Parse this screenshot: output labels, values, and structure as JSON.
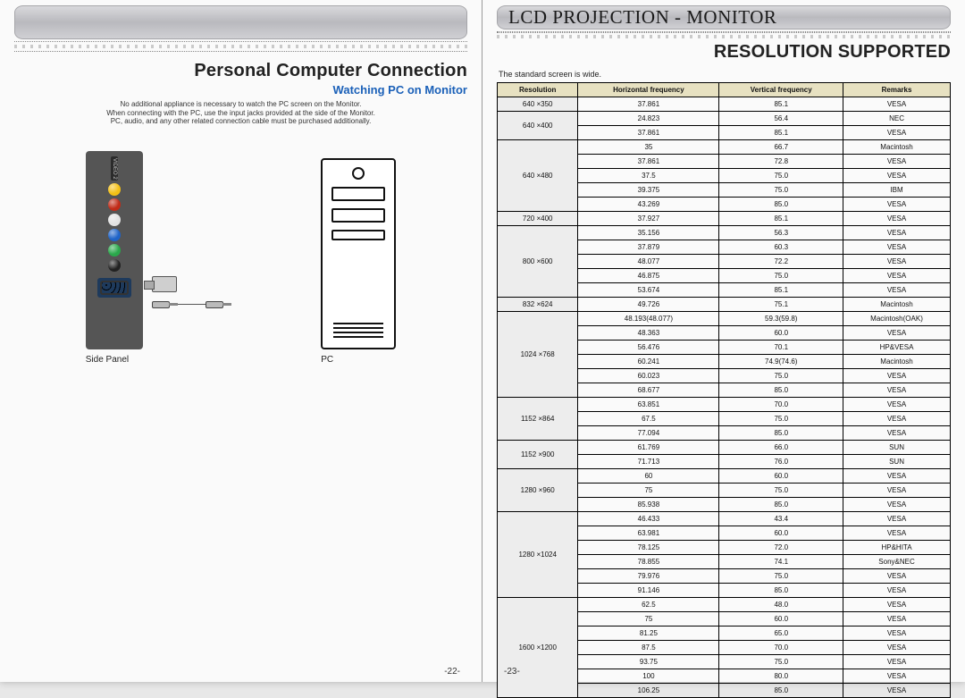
{
  "left": {
    "header": "",
    "title": "Personal Computer Connection",
    "subtitle": "Watching PC on Monitor",
    "intro1": "No additional appliance is necessary to watch the PC screen on the Monitor.",
    "intro2": "When connecting with the PC, use the input jacks provided at the side of the Monitor.",
    "intro3": "PC, audio, and any other related connection cable must be purchased additionally.",
    "sidepanel_label": "Side Panel",
    "pc_label": "PC",
    "pageno": "-22-"
  },
  "right": {
    "header": "LCD PROJECTION -  MONITOR",
    "title": "RESOLUTION SUPPORTED",
    "caption": "The standard screen is wide.",
    "pageno": "-23-",
    "table": {
      "headers": [
        "Resolution",
        "Horizontal frequency",
        "Vertical frequency",
        "Remarks"
      ],
      "groups": [
        {
          "res": "640 ×350",
          "rows": [
            [
              "37.861",
              "85.1",
              "VESA"
            ]
          ]
        },
        {
          "res": "640 ×400",
          "rows": [
            [
              "24.823",
              "56.4",
              "NEC"
            ],
            [
              "37.861",
              "85.1",
              "VESA"
            ]
          ]
        },
        {
          "res": "640 ×480",
          "rows": [
            [
              "35",
              "66.7",
              "Macintosh"
            ],
            [
              "37.861",
              "72.8",
              "VESA"
            ],
            [
              "37.5",
              "75.0",
              "VESA"
            ],
            [
              "39.375",
              "75.0",
              "IBM"
            ],
            [
              "43.269",
              "85.0",
              "VESA"
            ]
          ]
        },
        {
          "res": "720 ×400",
          "rows": [
            [
              "37.927",
              "85.1",
              "VESA"
            ]
          ]
        },
        {
          "res": "800 ×600",
          "rows": [
            [
              "35.156",
              "56.3",
              "VESA"
            ],
            [
              "37.879",
              "60.3",
              "VESA"
            ],
            [
              "48.077",
              "72.2",
              "VESA"
            ],
            [
              "46.875",
              "75.0",
              "VESA"
            ],
            [
              "53.674",
              "85.1",
              "VESA"
            ]
          ]
        },
        {
          "res": "832 ×624",
          "rows": [
            [
              "49.726",
              "75.1",
              "Macintosh"
            ]
          ]
        },
        {
          "res": "1024 ×768",
          "rows": [
            [
              "48.193(48.077)",
              "59.3(59.8)",
              "Macintosh(OAK)"
            ],
            [
              "48.363",
              "60.0",
              "VESA"
            ],
            [
              "56.476",
              "70.1",
              "HP&VESA"
            ],
            [
              "60.241",
              "74.9(74.6)",
              "Macintosh"
            ],
            [
              "60.023",
              "75.0",
              "VESA"
            ],
            [
              "68.677",
              "85.0",
              "VESA"
            ]
          ]
        },
        {
          "res": "1152 ×864",
          "rows": [
            [
              "63.851",
              "70.0",
              "VESA"
            ],
            [
              "67.5",
              "75.0",
              "VESA"
            ],
            [
              "77.094",
              "85.0",
              "VESA"
            ]
          ]
        },
        {
          "res": "1152 ×900",
          "rows": [
            [
              "61.769",
              "66.0",
              "SUN"
            ],
            [
              "71.713",
              "76.0",
              "SUN"
            ]
          ]
        },
        {
          "res": "1280 ×960",
          "rows": [
            [
              "60",
              "60.0",
              "VESA"
            ],
            [
              "75",
              "75.0",
              "VESA"
            ],
            [
              "85.938",
              "85.0",
              "VESA"
            ]
          ]
        },
        {
          "res": "1280 ×1024",
          "rows": [
            [
              "46.433",
              "43.4",
              "VESA"
            ],
            [
              "63.981",
              "60.0",
              "VESA"
            ],
            [
              "78.125",
              "72.0",
              "HP&HITA"
            ],
            [
              "78.855",
              "74.1",
              "Sony&NEC"
            ],
            [
              "79.976",
              "75.0",
              "VESA"
            ],
            [
              "91.146",
              "85.0",
              "VESA"
            ]
          ]
        },
        {
          "res": "1600 ×1200",
          "rows": [
            [
              "62.5",
              "48.0",
              "VESA"
            ],
            [
              "75",
              "60.0",
              "VESA"
            ],
            [
              "81.25",
              "65.0",
              "VESA"
            ],
            [
              "87.5",
              "70.0",
              "VESA"
            ],
            [
              "93.75",
              "75.0",
              "VESA"
            ],
            [
              "100",
              "80.0",
              "VESA"
            ],
            [
              "106.25",
              "85.0",
              "VESA"
            ]
          ]
        }
      ]
    }
  }
}
